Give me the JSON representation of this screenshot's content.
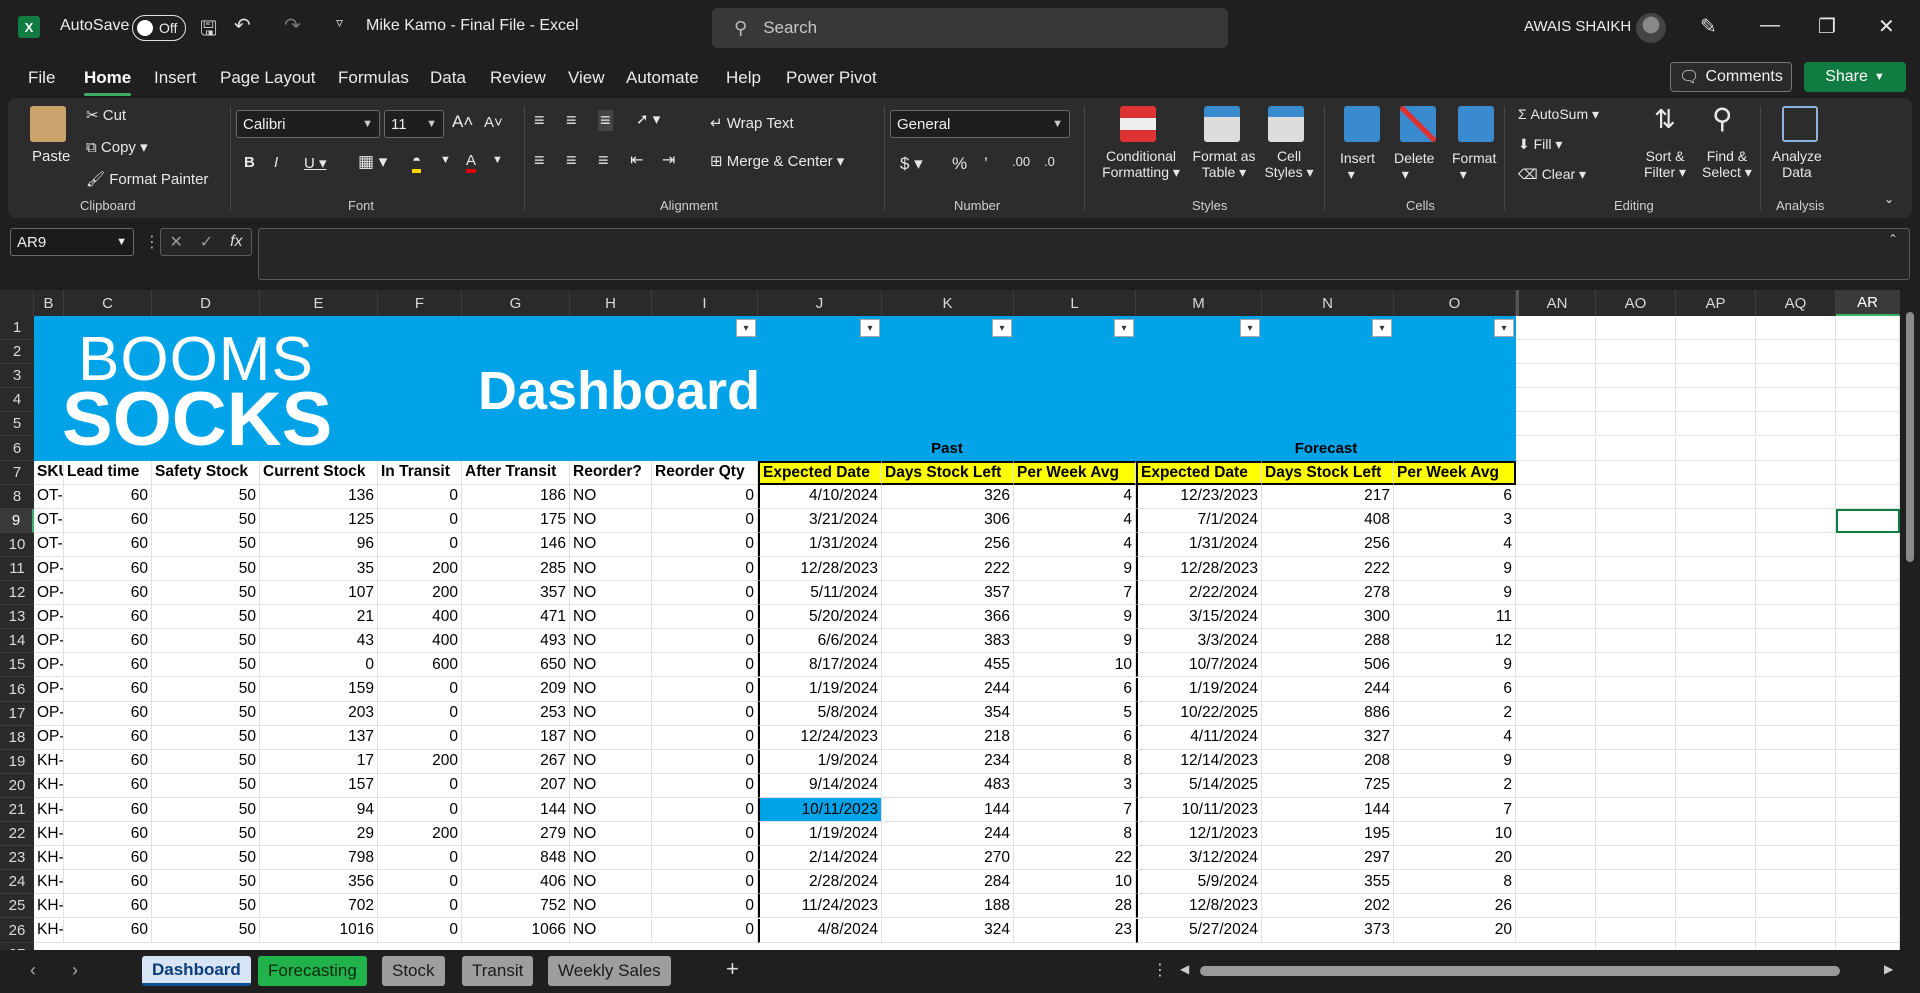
{
  "titlebar": {
    "app_icon": "X",
    "autosave_label": "AutoSave",
    "toggle_label": "Off",
    "doc_title": "Mike Kamo - Final File  -  Excel",
    "search_placeholder": "Search",
    "user_name": "AWAIS SHAIKH"
  },
  "menu": {
    "tabs": [
      "File",
      "Home",
      "Insert",
      "Page Layout",
      "Formulas",
      "Data",
      "Review",
      "View",
      "Automate",
      "Help",
      "Power Pivot"
    ],
    "active": "Home",
    "comments_label": "Comments",
    "share_label": "Share"
  },
  "ribbon": {
    "clipboard": {
      "paste": "Paste",
      "cut": "Cut",
      "copy": "Copy",
      "format_painter": "Format Painter",
      "label": "Clipboard"
    },
    "font": {
      "family": "Calibri",
      "size": "11",
      "label": "Font"
    },
    "alignment": {
      "wrap": "Wrap Text",
      "merge": "Merge & Center",
      "label": "Alignment"
    },
    "number": {
      "format": "General",
      "label": "Number"
    },
    "styles": {
      "cond": "Conditional",
      "cond2": "Formatting",
      "fmt_table": "Format as",
      "fmt_table2": "Table",
      "cell_styles": "Cell",
      "cell_styles2": "Styles",
      "label": "Styles"
    },
    "cells": {
      "insert": "Insert",
      "delete": "Delete",
      "format": "Format",
      "label": "Cells"
    },
    "editing": {
      "autosum": "AutoSum",
      "fill": "Fill",
      "clear": "Clear",
      "sort": "Sort &",
      "sort2": "Filter",
      "find": "Find &",
      "find2": "Select",
      "label": "Editing"
    },
    "analysis": {
      "analyze": "Analyze",
      "analyze2": "Data",
      "label": "Analysis"
    }
  },
  "formula_bar": {
    "name_box": "AR9",
    "fx": "fx",
    "formula": ""
  },
  "columns": [
    "B",
    "C",
    "D",
    "E",
    "F",
    "G",
    "H",
    "I",
    "J",
    "K",
    "L",
    "M",
    "N",
    "O",
    "AN",
    "AO",
    "AP",
    "AQ",
    "AR"
  ],
  "selected_column": "AR",
  "selected_row": "9",
  "banner": {
    "brand_line1": "BOOMS",
    "brand_line2": "SOCKS",
    "title": "Dashboard",
    "past": "Past",
    "forecast": "Forecast"
  },
  "headers": [
    "SKU",
    "Lead time",
    "Safety Stock",
    "Current Stock",
    "In Transit",
    "After Transit",
    "Reorder?",
    "Reorder Qty",
    "Expected Date",
    "Days Stock Left",
    "Per Week Avg",
    "Expected Date",
    "Days Stock Left",
    "Per Week Avg"
  ],
  "rows": [
    {
      "n": "8",
      "sku": "OT-I",
      "lt": "60",
      "ss": "50",
      "cs": "136",
      "it": "0",
      "at": "186",
      "ro": "NO",
      "rq": "0",
      "ed": "4/10/2024",
      "dl": "326",
      "pw": "4",
      "fed": "12/23/2023",
      "fdl": "217",
      "fpw": "6"
    },
    {
      "n": "9",
      "sku": "OT-I",
      "lt": "60",
      "ss": "50",
      "cs": "125",
      "it": "0",
      "at": "175",
      "ro": "NO",
      "rq": "0",
      "ed": "3/21/2024",
      "dl": "306",
      "pw": "4",
      "fed": "7/1/2024",
      "fdl": "408",
      "fpw": "3"
    },
    {
      "n": "10",
      "sku": "OT-I",
      "lt": "60",
      "ss": "50",
      "cs": "96",
      "it": "0",
      "at": "146",
      "ro": "NO",
      "rq": "0",
      "ed": "1/31/2024",
      "dl": "256",
      "pw": "4",
      "fed": "1/31/2024",
      "fdl": "256",
      "fpw": "4"
    },
    {
      "n": "11",
      "sku": "OP-I",
      "lt": "60",
      "ss": "50",
      "cs": "35",
      "it": "200",
      "at": "285",
      "ro": "NO",
      "rq": "0",
      "ed": "12/28/2023",
      "dl": "222",
      "pw": "9",
      "fed": "12/28/2023",
      "fdl": "222",
      "fpw": "9"
    },
    {
      "n": "12",
      "sku": "OP-I",
      "lt": "60",
      "ss": "50",
      "cs": "107",
      "it": "200",
      "at": "357",
      "ro": "NO",
      "rq": "0",
      "ed": "5/11/2024",
      "dl": "357",
      "pw": "7",
      "fed": "2/22/2024",
      "fdl": "278",
      "fpw": "9"
    },
    {
      "n": "13",
      "sku": "OP-I",
      "lt": "60",
      "ss": "50",
      "cs": "21",
      "it": "400",
      "at": "471",
      "ro": "NO",
      "rq": "0",
      "ed": "5/20/2024",
      "dl": "366",
      "pw": "9",
      "fed": "3/15/2024",
      "fdl": "300",
      "fpw": "11"
    },
    {
      "n": "14",
      "sku": "OP-I",
      "lt": "60",
      "ss": "50",
      "cs": "43",
      "it": "400",
      "at": "493",
      "ro": "NO",
      "rq": "0",
      "ed": "6/6/2024",
      "dl": "383",
      "pw": "9",
      "fed": "3/3/2024",
      "fdl": "288",
      "fpw": "12"
    },
    {
      "n": "15",
      "sku": "OP-I",
      "lt": "60",
      "ss": "50",
      "cs": "0",
      "it": "600",
      "at": "650",
      "ro": "NO",
      "rq": "0",
      "ed": "8/17/2024",
      "dl": "455",
      "pw": "10",
      "fed": "10/7/2024",
      "fdl": "506",
      "fpw": "9"
    },
    {
      "n": "16",
      "sku": "OP-I",
      "lt": "60",
      "ss": "50",
      "cs": "159",
      "it": "0",
      "at": "209",
      "ro": "NO",
      "rq": "0",
      "ed": "1/19/2024",
      "dl": "244",
      "pw": "6",
      "fed": "1/19/2024",
      "fdl": "244",
      "fpw": "6"
    },
    {
      "n": "17",
      "sku": "OP-I",
      "lt": "60",
      "ss": "50",
      "cs": "203",
      "it": "0",
      "at": "253",
      "ro": "NO",
      "rq": "0",
      "ed": "5/8/2024",
      "dl": "354",
      "pw": "5",
      "fed": "10/22/2025",
      "fdl": "886",
      "fpw": "2"
    },
    {
      "n": "18",
      "sku": "OP-I",
      "lt": "60",
      "ss": "50",
      "cs": "137",
      "it": "0",
      "at": "187",
      "ro": "NO",
      "rq": "0",
      "ed": "12/24/2023",
      "dl": "218",
      "pw": "6",
      "fed": "4/11/2024",
      "fdl": "327",
      "fpw": "4"
    },
    {
      "n": "19",
      "sku": "KH-\\",
      "lt": "60",
      "ss": "50",
      "cs": "17",
      "it": "200",
      "at": "267",
      "ro": "NO",
      "rq": "0",
      "ed": "1/9/2024",
      "dl": "234",
      "pw": "8",
      "fed": "12/14/2023",
      "fdl": "208",
      "fpw": "9"
    },
    {
      "n": "20",
      "sku": "KH-\\",
      "lt": "60",
      "ss": "50",
      "cs": "157",
      "it": "0",
      "at": "207",
      "ro": "NO",
      "rq": "0",
      "ed": "9/14/2024",
      "dl": "483",
      "pw": "3",
      "fed": "5/14/2025",
      "fdl": "725",
      "fpw": "2"
    },
    {
      "n": "21",
      "sku": "KH-\\",
      "lt": "60",
      "ss": "50",
      "cs": "94",
      "it": "0",
      "at": "144",
      "ro": "NO",
      "rq": "0",
      "ed": "10/11/2023",
      "dl": "144",
      "pw": "7",
      "fed": "10/11/2023",
      "fdl": "144",
      "fpw": "7",
      "hl": true
    },
    {
      "n": "22",
      "sku": "KH-\\",
      "lt": "60",
      "ss": "50",
      "cs": "29",
      "it": "200",
      "at": "279",
      "ro": "NO",
      "rq": "0",
      "ed": "1/19/2024",
      "dl": "244",
      "pw": "8",
      "fed": "12/1/2023",
      "fdl": "195",
      "fpw": "10"
    },
    {
      "n": "23",
      "sku": "KH-I",
      "lt": "60",
      "ss": "50",
      "cs": "798",
      "it": "0",
      "at": "848",
      "ro": "NO",
      "rq": "0",
      "ed": "2/14/2024",
      "dl": "270",
      "pw": "22",
      "fed": "3/12/2024",
      "fdl": "297",
      "fpw": "20"
    },
    {
      "n": "24",
      "sku": "KH-I",
      "lt": "60",
      "ss": "50",
      "cs": "356",
      "it": "0",
      "at": "406",
      "ro": "NO",
      "rq": "0",
      "ed": "2/28/2024",
      "dl": "284",
      "pw": "10",
      "fed": "5/9/2024",
      "fdl": "355",
      "fpw": "8"
    },
    {
      "n": "25",
      "sku": "KH-I",
      "lt": "60",
      "ss": "50",
      "cs": "702",
      "it": "0",
      "at": "752",
      "ro": "NO",
      "rq": "0",
      "ed": "11/24/2023",
      "dl": "188",
      "pw": "28",
      "fed": "12/8/2023",
      "fdl": "202",
      "fpw": "26"
    },
    {
      "n": "26",
      "sku": "KH-I",
      "lt": "60",
      "ss": "50",
      "cs": "1016",
      "it": "0",
      "at": "1066",
      "ro": "NO",
      "rq": "0",
      "ed": "4/8/2024",
      "dl": "324",
      "pw": "23",
      "fed": "5/27/2024",
      "fdl": "373",
      "fpw": "20"
    }
  ],
  "sheets": [
    {
      "name": "Dashboard",
      "active": true,
      "color": "#0b5394"
    },
    {
      "name": "Forecasting",
      "active": false,
      "color": "#21b24b"
    },
    {
      "name": "Stock",
      "active": false,
      "color": "#9e9e9e"
    },
    {
      "name": "Transit",
      "active": false,
      "color": "#9e9e9e"
    },
    {
      "name": "Weekly Sales",
      "active": false,
      "color": "#9e9e9e"
    }
  ],
  "colors": {
    "banner": "#00a2e8",
    "header_yellow": "#ffff00",
    "excel_green": "#107c41"
  }
}
